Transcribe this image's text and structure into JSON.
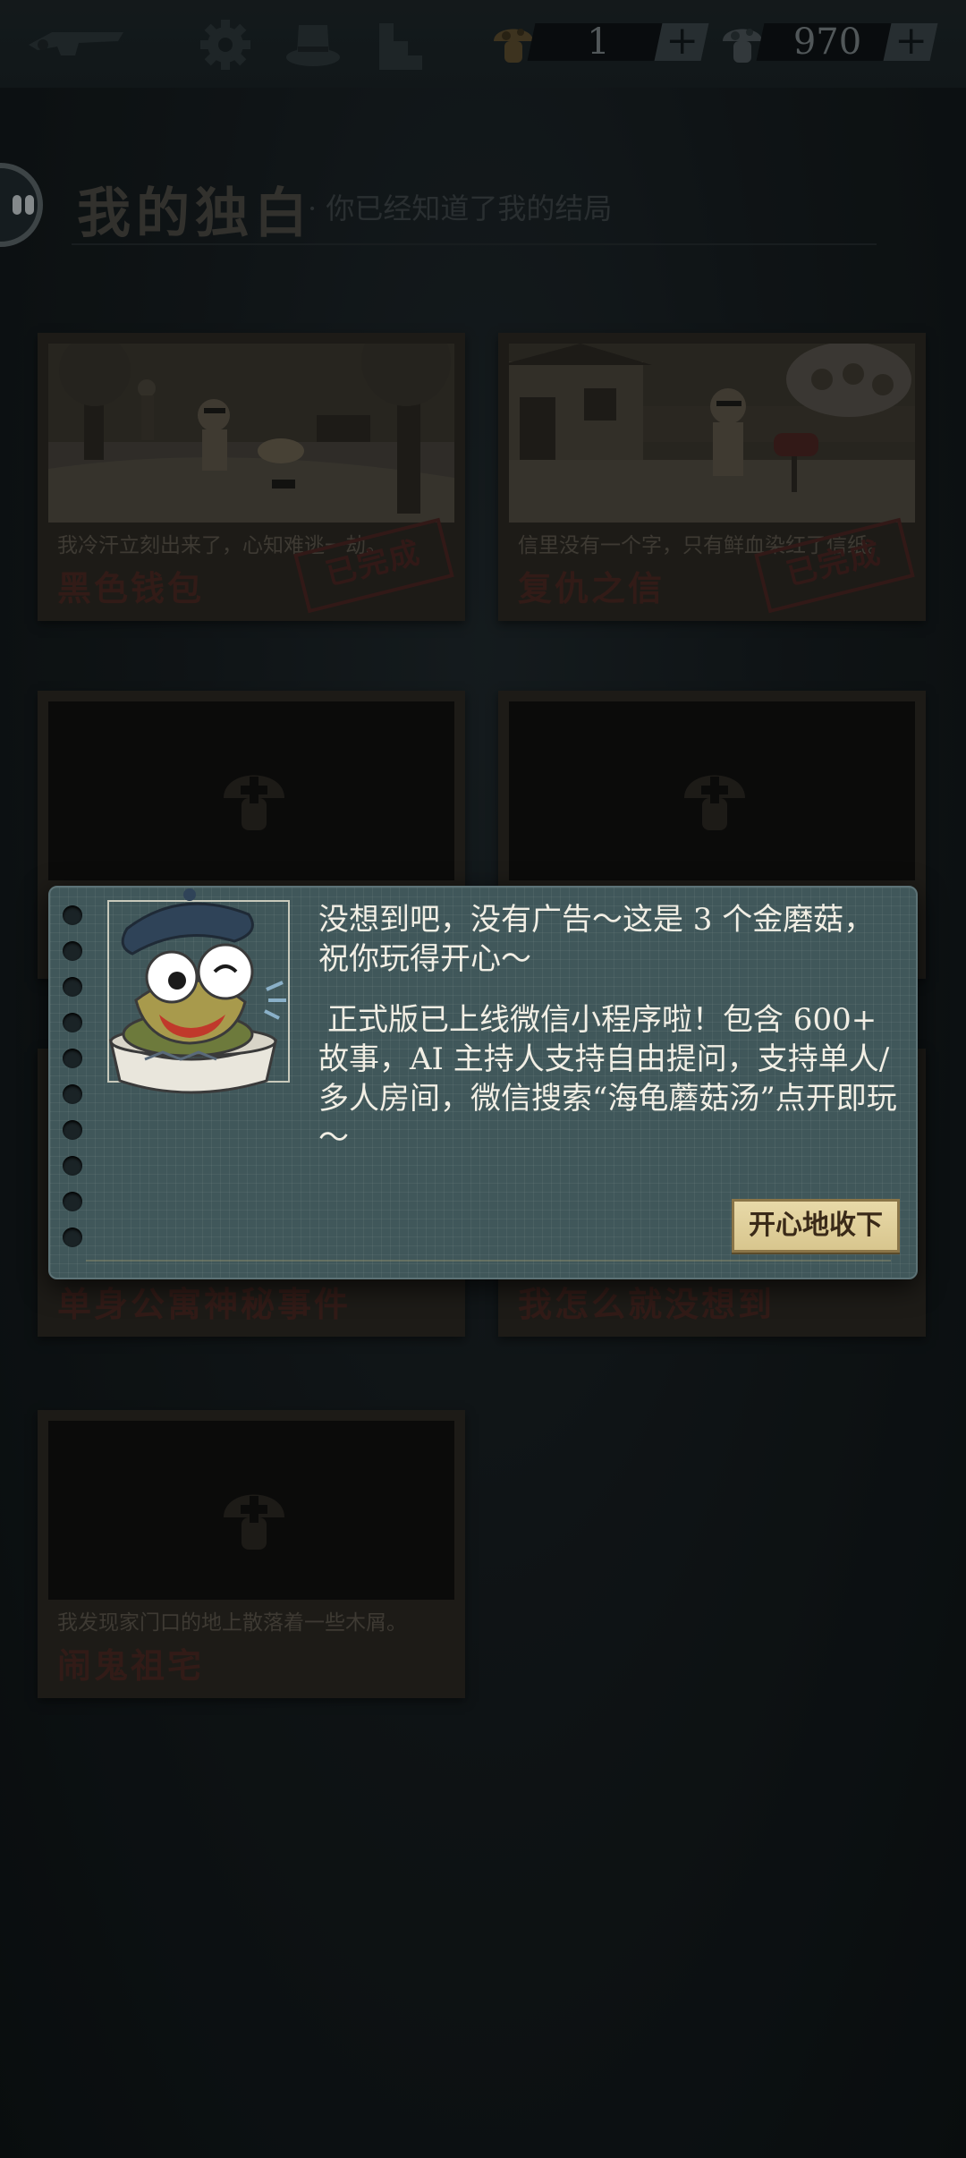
{
  "topbar": {
    "logo_icon": "gun-logo-icon",
    "settings_icon": "gear-icon",
    "hat_icon": "hat-icon",
    "steps_icon": "stairs-icon",
    "gold_mushrooms": {
      "icon": "gold-mushroom-icon",
      "count": "1",
      "plus": "+"
    },
    "mushrooms": {
      "icon": "mushroom-icon",
      "count": "970",
      "plus": "+"
    }
  },
  "header": {
    "back_icon": "back-icon",
    "title": "我的独白",
    "subtitle": "· 你已经知道了我的结局"
  },
  "cards": [
    {
      "name": "黑色钱包",
      "hint": "我冷汗立刻出来了，心知难逃一劫。",
      "stamp": "已完成",
      "state": "completed"
    },
    {
      "name": "复仇之信",
      "hint": "信里没有一个字，只有鲜血染红了信纸。",
      "stamp": "已完成",
      "state": "completed"
    },
    {
      "name": "",
      "hint": "",
      "state": "locked"
    },
    {
      "name": "",
      "hint": "",
      "state": "locked"
    },
    {
      "name": "单身公寓神秘事件",
      "hint": "",
      "state": "locked"
    },
    {
      "name": "我怎么就没想到",
      "hint": "",
      "state": "locked"
    },
    {
      "name": "闹鬼祖宅",
      "hint": "我发现家门口的地上散落着一些木屑。",
      "state": "locked"
    }
  ],
  "modal": {
    "mascot": "turtle-mascot-icon",
    "line1": "没想到吧，没有广告～这是 3 个金磨菇，祝你玩得开心～",
    "line2": "正式版已上线微信小程序啦！包含 600+ 故事，AI 主持人支持自由提问，支持单人/多人房间，微信搜索“海龟蘑菇汤”点开即玩～",
    "button": "开心地收下"
  },
  "colors": {
    "background": "#141a1d",
    "modal": "#40575a",
    "card": "#2a2620",
    "stamp": "#4a2220",
    "button": "#e0d09a"
  }
}
